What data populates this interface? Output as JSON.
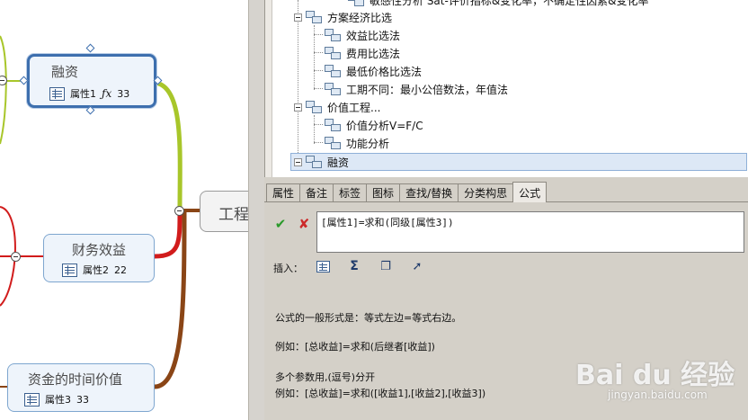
{
  "mindmap": {
    "nodes": [
      {
        "title": "融资",
        "attr_label": "属性1",
        "attr_formula_icon": "fx-icon",
        "attr_value": "33",
        "selected": true
      },
      {
        "title": "财务效益",
        "attr_label": "属性2",
        "attr_value": "22"
      },
      {
        "title": "资金的时间价值",
        "attr_label": "属性3",
        "attr_value": "33"
      }
    ],
    "root_label": "工程"
  },
  "tree": {
    "rows": [
      {
        "label": "敏感性分析 Sat-评价指标&变化率，不确定性因素&变化率",
        "level": 3
      },
      {
        "label": "方案经济比选",
        "level": 1,
        "expanded": true
      },
      {
        "label": "效益比选法",
        "level": 2
      },
      {
        "label": "费用比选法",
        "level": 2
      },
      {
        "label": "最低价格比选法",
        "level": 2
      },
      {
        "label": "工期不同：最小公倍数法，年值法",
        "level": 2
      },
      {
        "label": "价值工程...",
        "level": 1,
        "expanded": true
      },
      {
        "label": "价值分析V=F/C",
        "level": 2
      },
      {
        "label": "功能分析",
        "level": 2
      },
      {
        "label": "融资",
        "level": 1,
        "selected": true
      }
    ]
  },
  "panel": {
    "tabs": [
      "属性",
      "备注",
      "标签",
      "图标",
      "查找/替换",
      "分类构思",
      "公式"
    ],
    "active_tab": "公式",
    "formula": "[属性1]=求和(同级[属性3])",
    "insert_label": "插入：",
    "insert_buttons": [
      "attribute-icon",
      "sigma-icon",
      "copy-icon",
      "pointer-icon"
    ],
    "description": [
      "公式的一般形式是：等式左边=等式右边。",
      "例如：[总收益]=求和(后继者[收益])",
      "多个参数用,(逗号)分开",
      "例如：[总收益]=求和([收益1],[收益2],[收益3])"
    ]
  },
  "watermark": {
    "logo": "Bai du 经验",
    "url": "jingyan.baidu.com"
  },
  "colors": {
    "green_branch": "#a8c62a",
    "red_branch": "#d11c1c",
    "brown_branch": "#8a4516",
    "node_border": "#7ea6cf",
    "selected_border": "#3d6fae"
  }
}
